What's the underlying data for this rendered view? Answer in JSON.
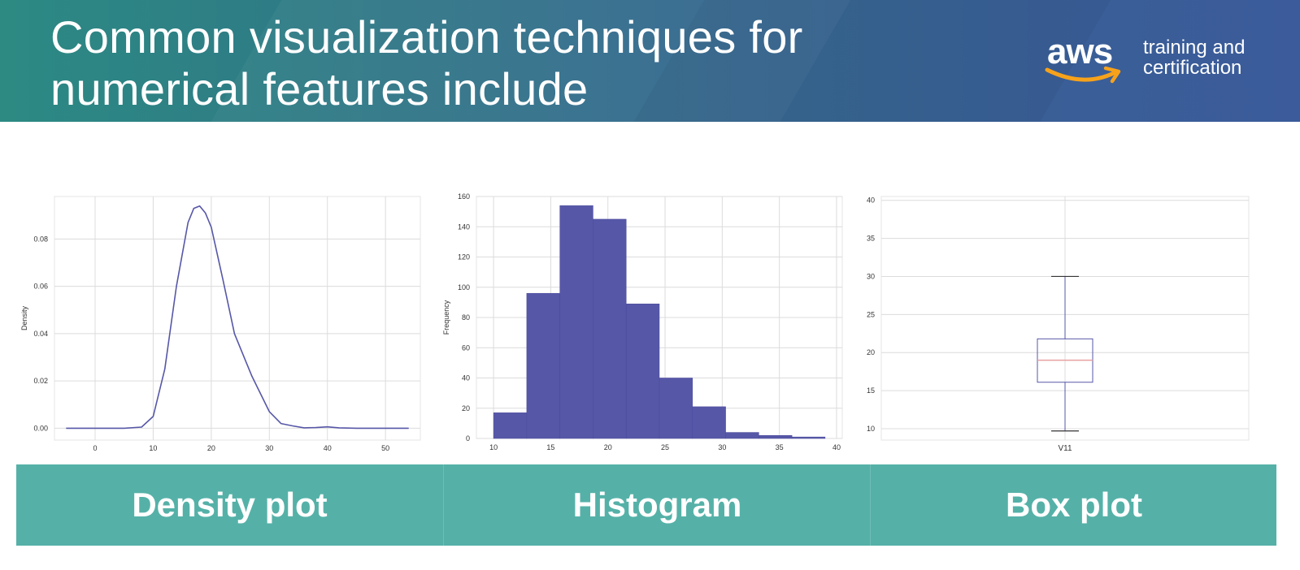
{
  "slide": {
    "title_line1": "Common visualization techniques for",
    "title_line2": "numerical features include",
    "logo": {
      "mark": "aws",
      "text_line1": "training and",
      "text_line2": "certification"
    }
  },
  "colors": {
    "series": "#5757a8",
    "median": "#e8a0a0",
    "band": "#55b1a8",
    "header_start": "#2c8a83",
    "header_end": "#3b5b9a"
  },
  "labels": {
    "density": "Density plot",
    "histogram": "Histogram",
    "box": "Box plot"
  },
  "chart_data": [
    {
      "type": "line",
      "title": "",
      "xlabel": "",
      "ylabel": "Density",
      "xlim": [
        -7,
        56
      ],
      "ylim": [
        -0.005,
        0.098
      ],
      "x_ticks": [
        0,
        10,
        20,
        30,
        40,
        50
      ],
      "y_ticks": [
        0.0,
        0.02,
        0.04,
        0.06,
        0.08
      ],
      "y_tick_labels": [
        "0.00",
        "0.02",
        "0.04",
        "0.06",
        "0.08"
      ],
      "grid": true,
      "series": [
        {
          "x": [
            -5,
            0,
            5,
            8,
            10,
            12,
            14,
            16,
            17,
            18,
            19,
            20,
            22,
            24,
            26,
            27,
            28,
            30,
            32,
            34,
            36,
            38,
            40,
            42,
            45,
            50,
            54
          ],
          "y": [
            0.0,
            0.0,
            0.0,
            0.0005,
            0.005,
            0.025,
            0.06,
            0.087,
            0.093,
            0.094,
            0.091,
            0.085,
            0.063,
            0.04,
            0.028,
            0.022,
            0.017,
            0.007,
            0.002,
            0.001,
            0.0002,
            0.0003,
            0.0006,
            0.0002,
            0.0,
            0.0,
            0.0
          ]
        }
      ]
    },
    {
      "type": "bar",
      "title": "",
      "xlabel": "",
      "ylabel": "Frequency",
      "xlim": [
        8.5,
        40.5
      ],
      "ylim": [
        0,
        160
      ],
      "x_ticks": [
        10,
        15,
        20,
        25,
        30,
        35,
        40
      ],
      "y_ticks": [
        0,
        20,
        40,
        60,
        80,
        100,
        120,
        140,
        160
      ],
      "grid": true,
      "bin_edges": [
        10,
        12.9,
        15.8,
        18.7,
        21.6,
        24.5,
        27.4,
        30.3,
        33.2,
        36.1,
        39.0
      ],
      "values": [
        17,
        96,
        154,
        145,
        89,
        40,
        21,
        4,
        2,
        1
      ]
    },
    {
      "type": "box",
      "title": "",
      "xlabel": "",
      "ylabel": "",
      "ylim": [
        8.5,
        40.5
      ],
      "y_ticks": [
        10,
        15,
        20,
        25,
        30,
        35,
        40
      ],
      "categories": [
        "V11"
      ],
      "grid": true,
      "boxes": [
        {
          "name": "V11",
          "whisker_low": 9.7,
          "q1": 16.1,
          "median": 19.0,
          "q3": 21.8,
          "whisker_high": 30.0
        }
      ]
    }
  ]
}
